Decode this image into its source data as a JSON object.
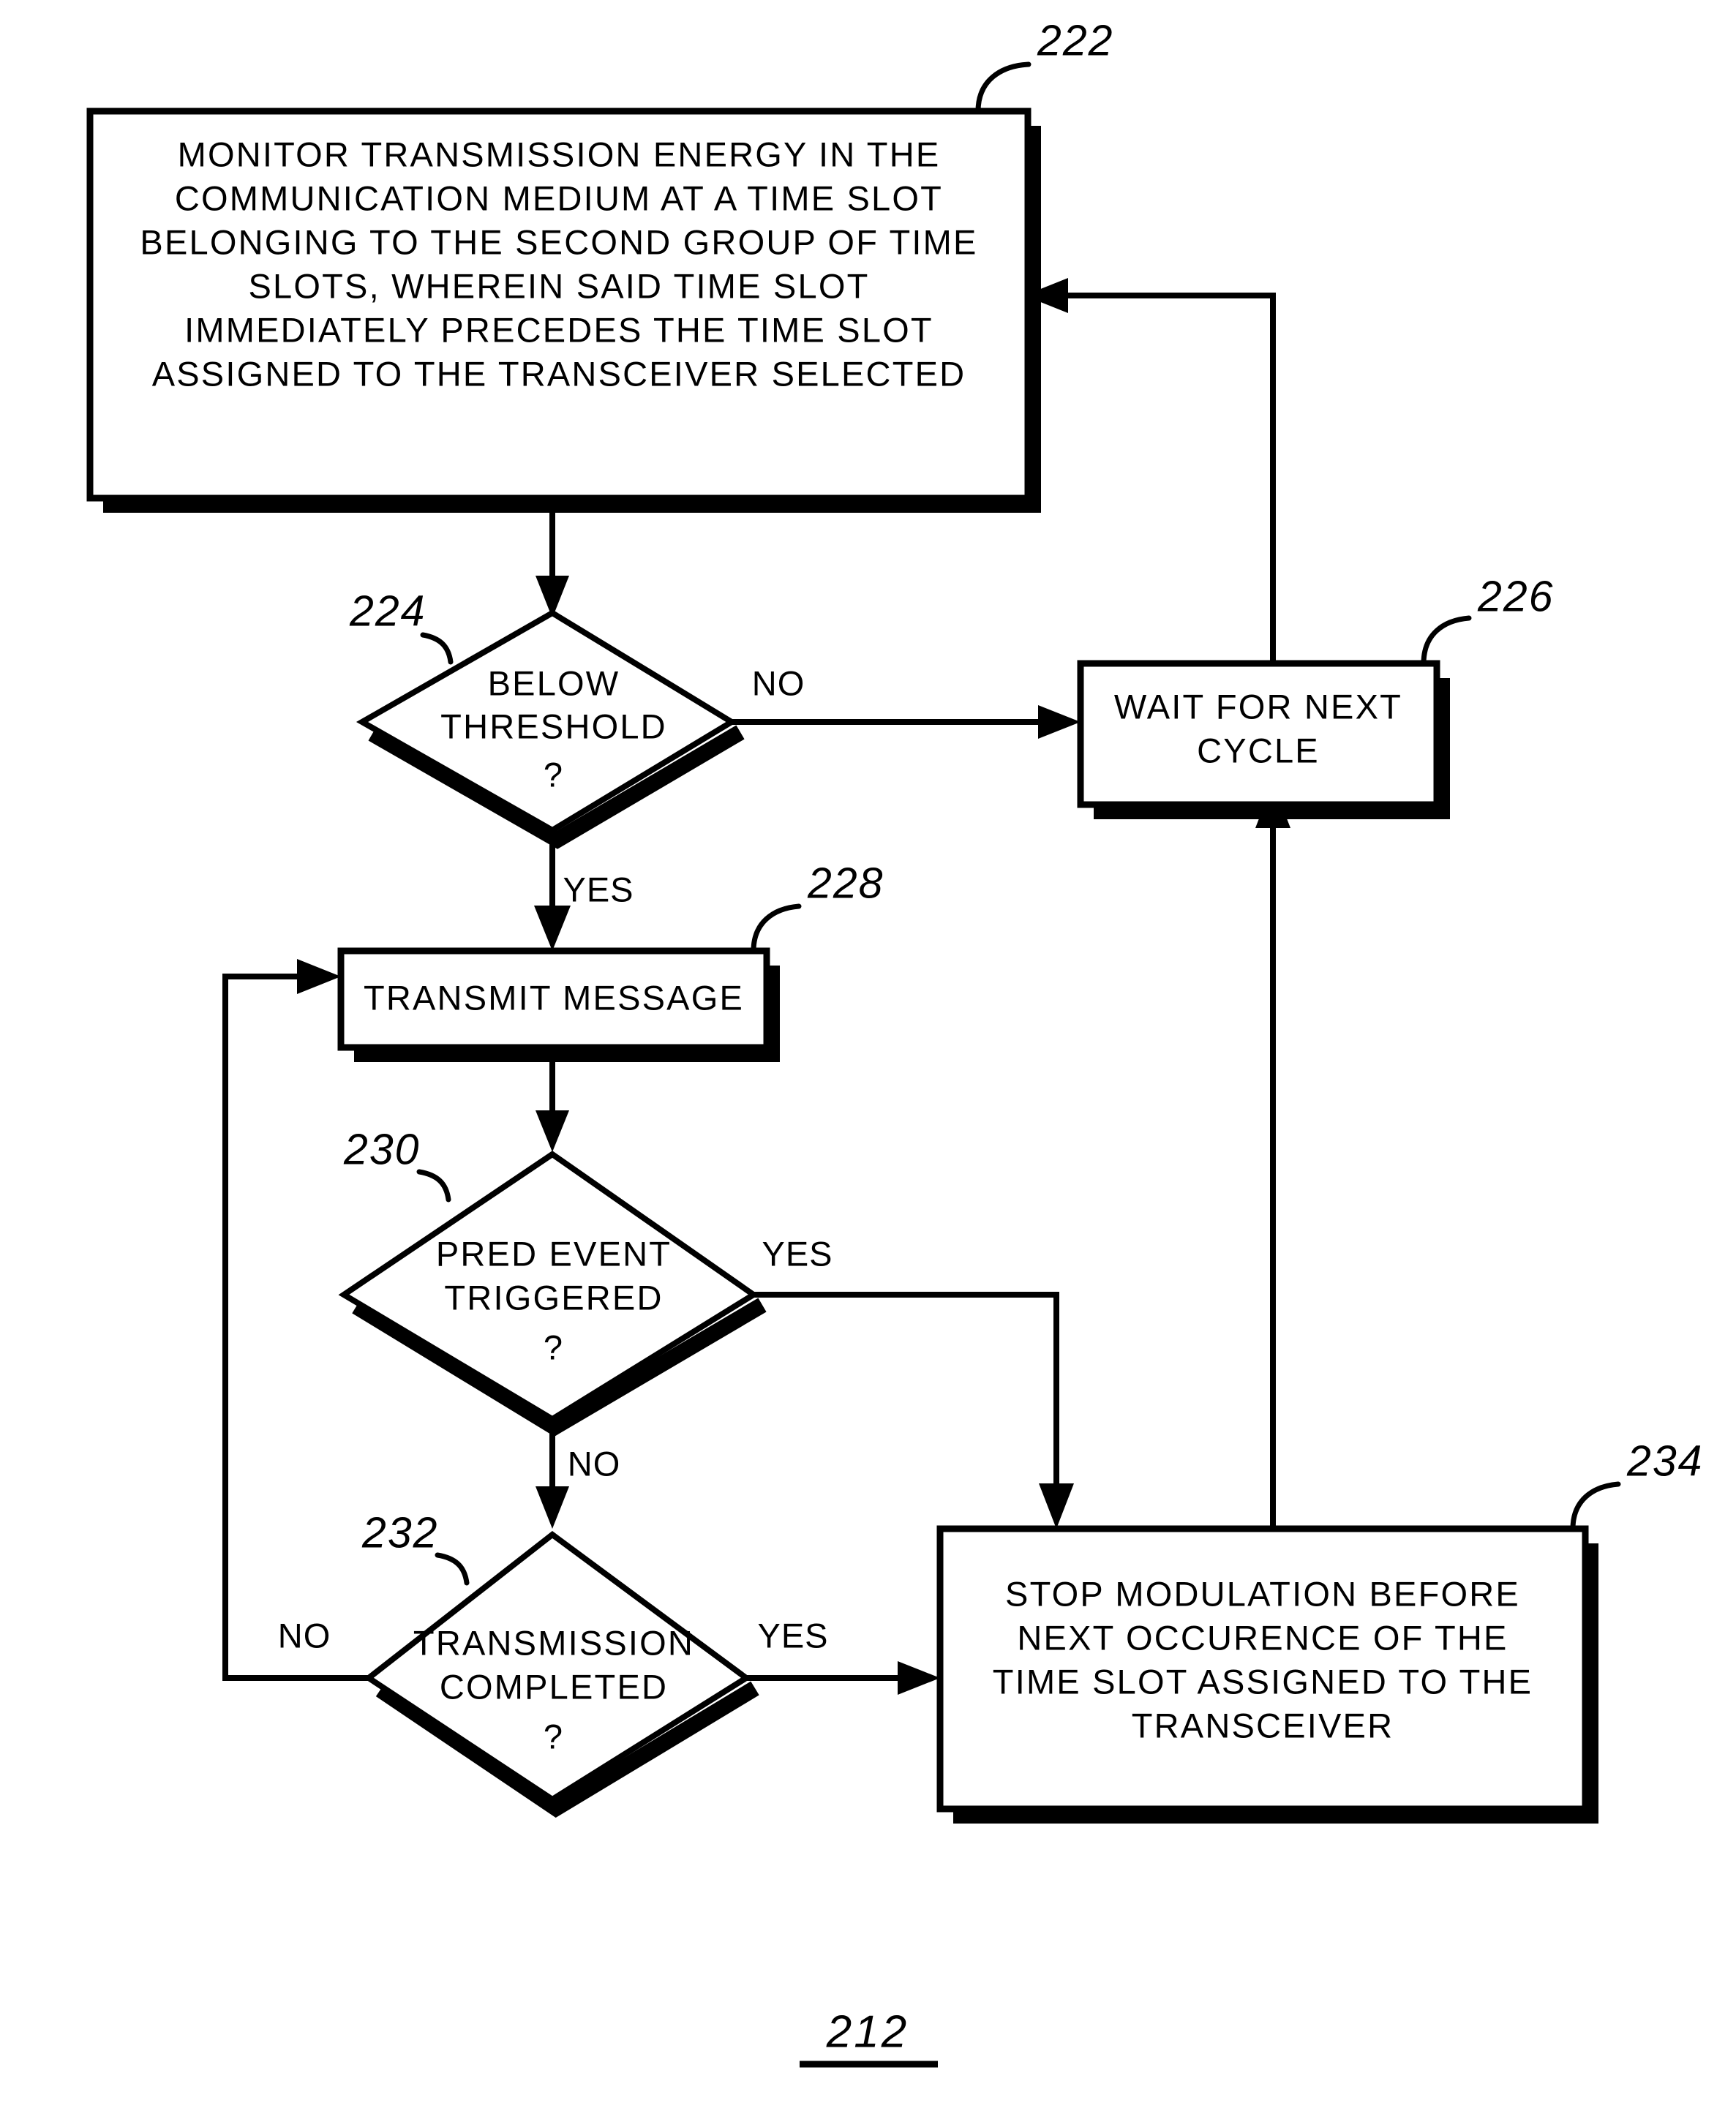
{
  "figure": {
    "number": "212",
    "kind": "patent-flowchart"
  },
  "nodes": {
    "monitor": {
      "ref": "222",
      "shape": "process",
      "lines": [
        "MONITOR TRANSMISSION ENERGY IN THE",
        "COMMUNICATION MEDIUM AT A TIME SLOT",
        "BELONGING TO THE SECOND GROUP OF TIME",
        "SLOTS, WHEREIN SAID TIME SLOT",
        "IMMEDIATELY PRECEDES THE TIME SLOT",
        "ASSIGNED TO THE TRANSCEIVER SELECTED"
      ]
    },
    "below_threshold": {
      "ref": "224",
      "shape": "decision",
      "lines": [
        "BELOW",
        "THRESHOLD",
        "?"
      ]
    },
    "wait_cycle": {
      "ref": "226",
      "shape": "process",
      "lines": [
        "WAIT FOR NEXT",
        "CYCLE"
      ]
    },
    "transmit_message": {
      "ref": "228",
      "shape": "process",
      "lines": [
        "TRANSMIT MESSAGE"
      ]
    },
    "pred_event": {
      "ref": "230",
      "shape": "decision",
      "lines": [
        "PRED EVENT",
        "TRIGGERED",
        "?"
      ]
    },
    "transmission_completed": {
      "ref": "232",
      "shape": "decision",
      "lines": [
        "TRANSMISSION",
        "COMPLETED",
        "?"
      ]
    },
    "stop_modulation": {
      "ref": "234",
      "shape": "process",
      "lines": [
        "STOP MODULATION BEFORE",
        "NEXT OCCURENCE OF THE",
        "TIME SLOT ASSIGNED TO THE",
        "TRANSCEIVER"
      ]
    }
  },
  "branch_labels": {
    "threshold_no": "NO",
    "threshold_yes": "YES",
    "pred_yes": "YES",
    "pred_no": "NO",
    "completed_no": "NO",
    "completed_yes": "YES"
  },
  "colors": {
    "ink": "#000000",
    "paper": "#ffffff"
  }
}
